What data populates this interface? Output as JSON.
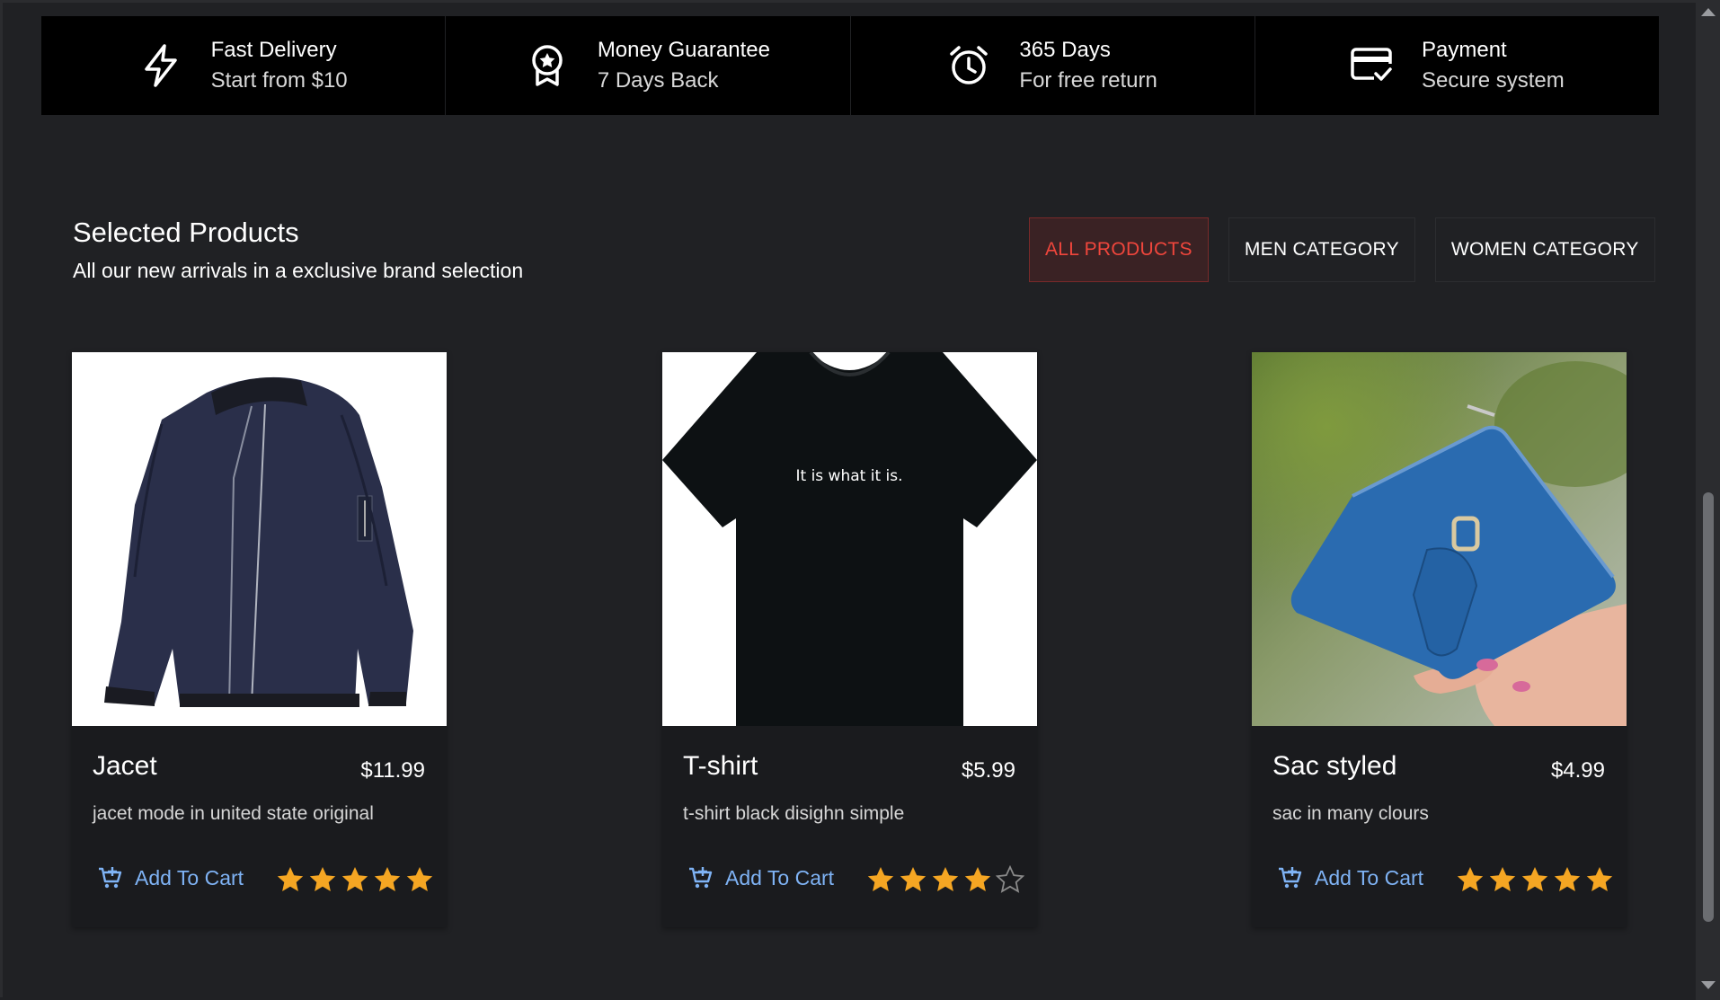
{
  "features": [
    {
      "icon": "lightning-icon",
      "title": "Fast Delivery",
      "subtitle": "Start from $10"
    },
    {
      "icon": "award-badge-icon",
      "title": "Money Guarantee",
      "subtitle": "7 Days Back"
    },
    {
      "icon": "alarm-clock-icon",
      "title": "365 Days",
      "subtitle": "For free return"
    },
    {
      "icon": "credit-card-check-icon",
      "title": "Payment",
      "subtitle": "Secure system"
    }
  ],
  "section": {
    "title": "Selected Products",
    "subtitle": "All our new arrivals in a exclusive brand selection"
  },
  "filters": [
    {
      "label": "ALL PRODUCTS",
      "active": true
    },
    {
      "label": "MEN CATEGORY",
      "active": false
    },
    {
      "label": "WOMEN CATEGORY",
      "active": false
    }
  ],
  "products": [
    {
      "name": "Jacet",
      "price": "$11.99",
      "description": "jacet mode in united state original",
      "cart_label": "Add To Cart",
      "rating": 5,
      "rating_max": 5,
      "image": "navy-bomber-jacket"
    },
    {
      "name": "T-shirt",
      "price": "$5.99",
      "description": "t-shirt black disighn simple",
      "cart_label": "Add To Cart",
      "rating": 4,
      "rating_max": 5,
      "image": "black-tshirt",
      "image_text": "It is what it is."
    },
    {
      "name": "Sac styled",
      "price": "$4.99",
      "description": "sac in many clours",
      "cart_label": "Add To Cart",
      "rating": 5,
      "rating_max": 5,
      "image": "blue-wallet-in-hand"
    }
  ],
  "colors": {
    "background": "#202124",
    "feature_bar": "#000000",
    "accent_red": "#f0463c",
    "cart_blue": "#7fb3f5",
    "star_gold": "#f5a623"
  }
}
